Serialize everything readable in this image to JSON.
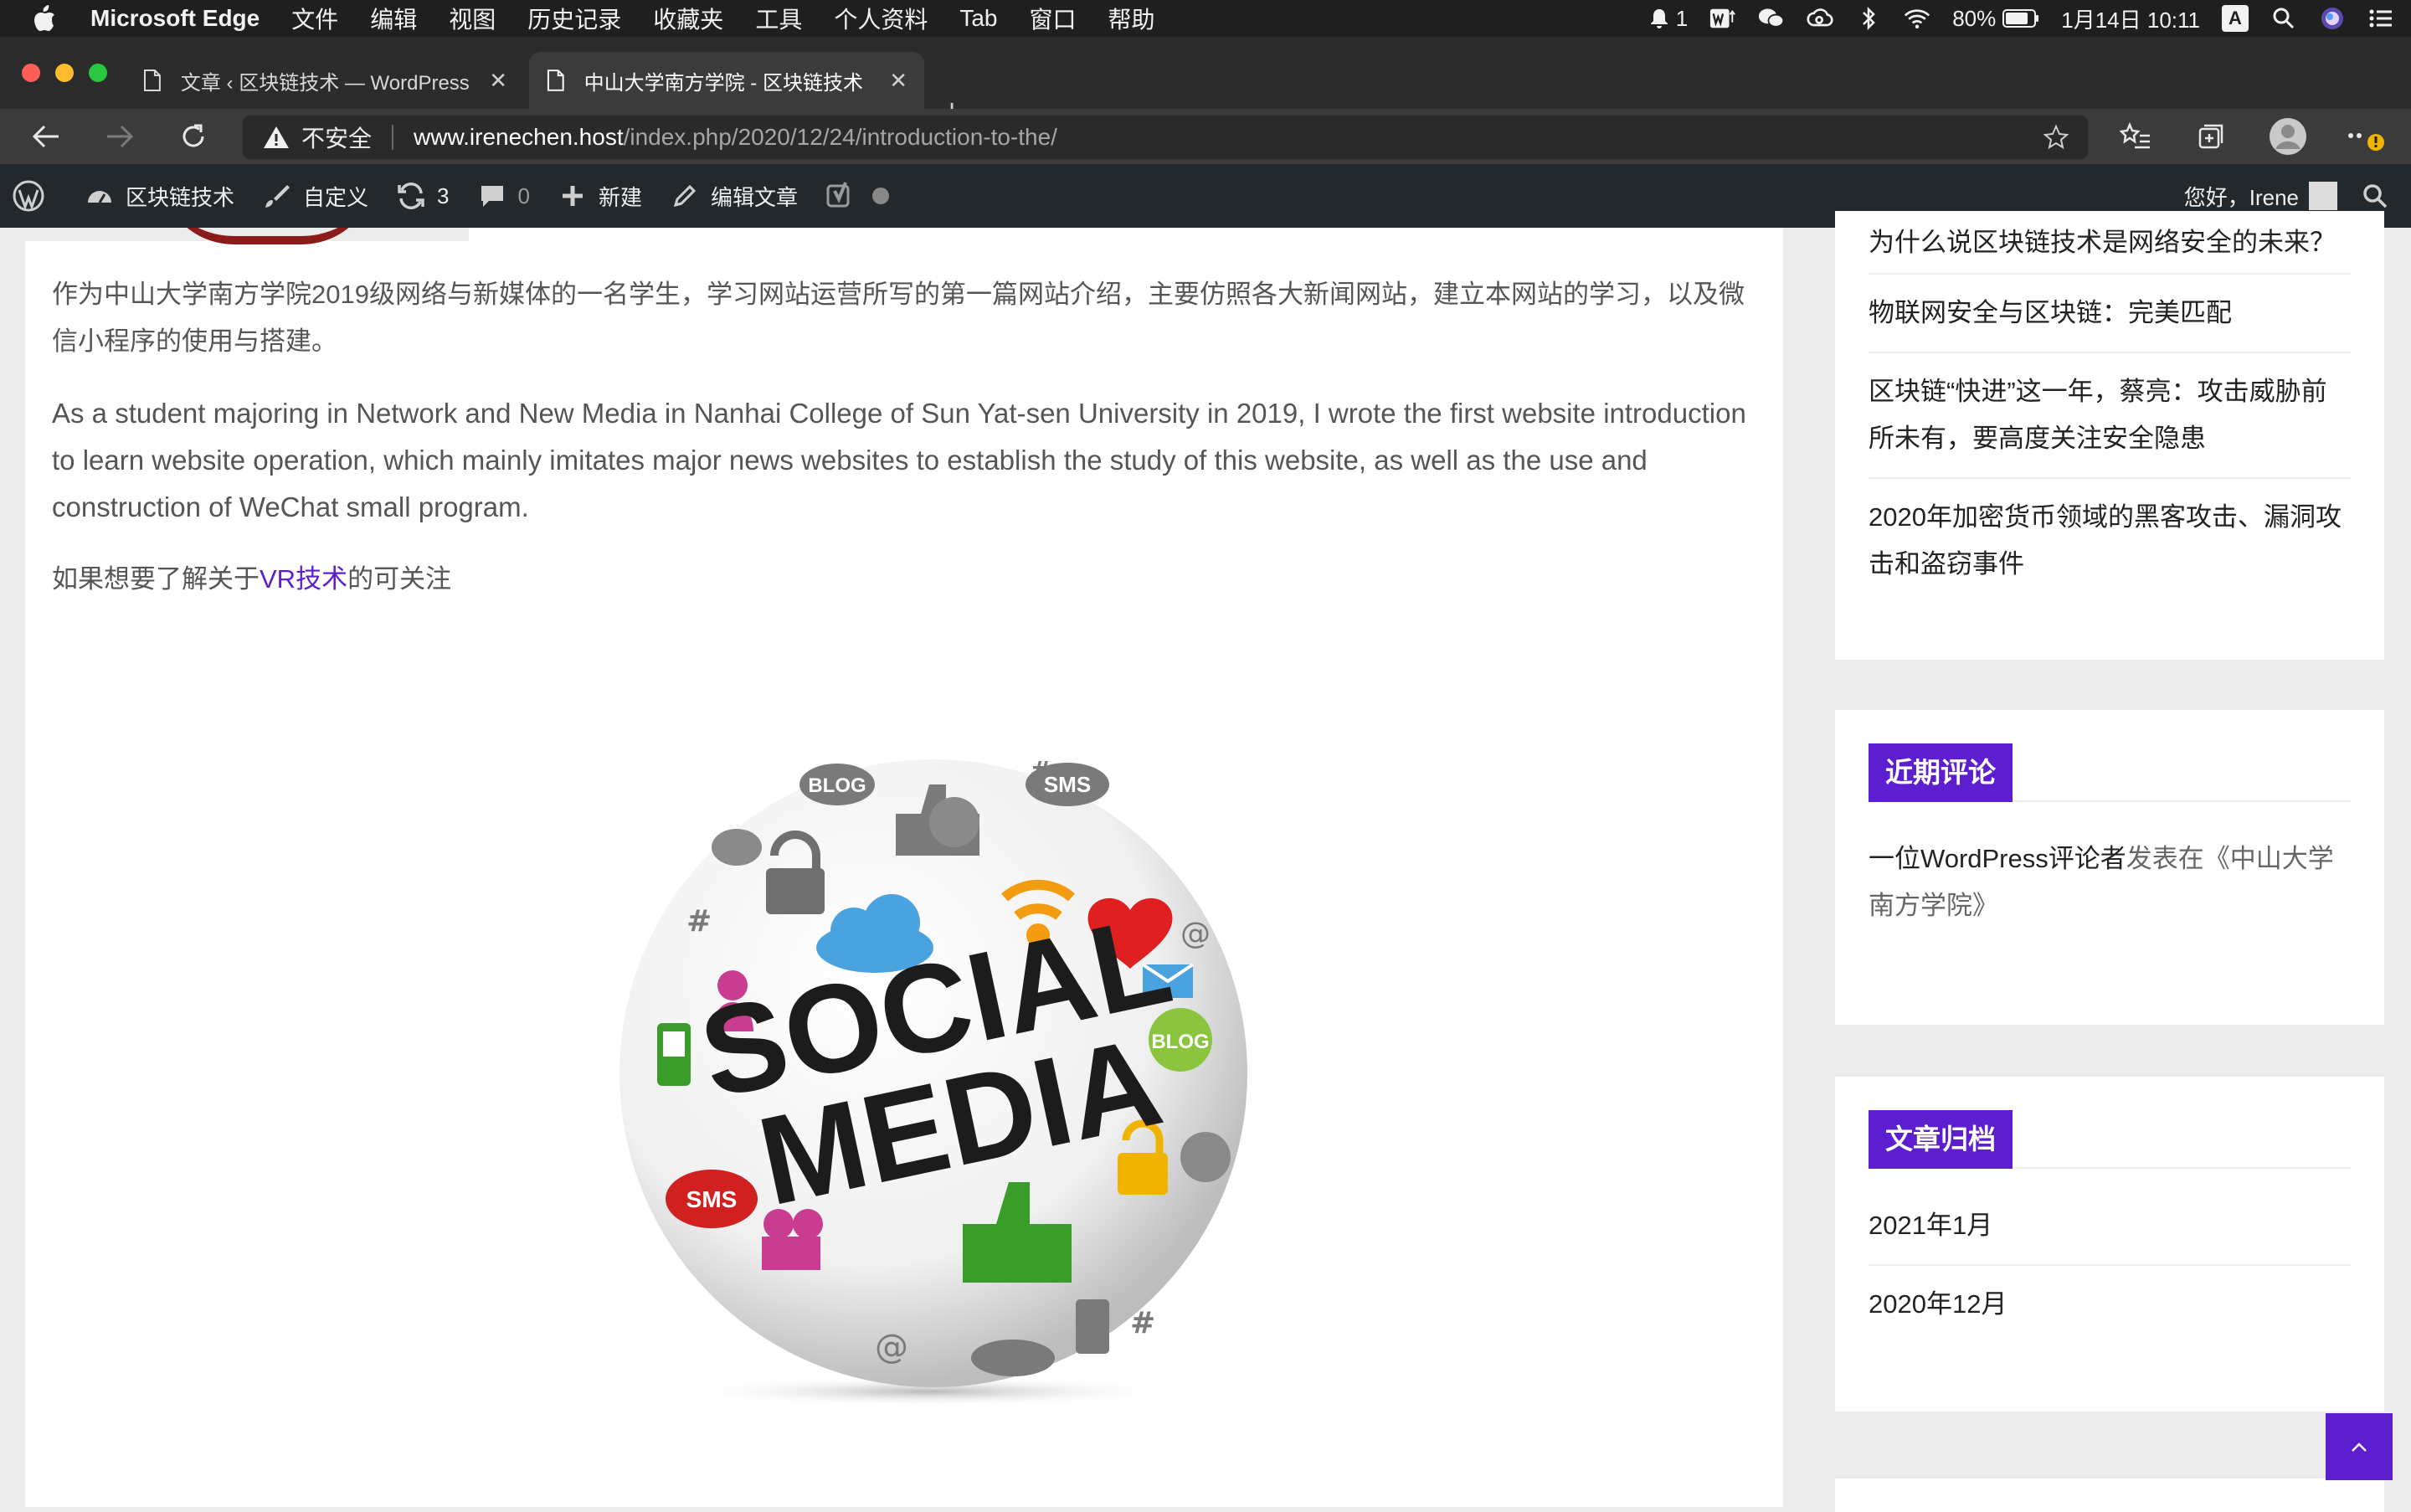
{
  "menubar": {
    "app_name": "Microsoft Edge",
    "items": [
      "文件",
      "编辑",
      "视图",
      "历史记录",
      "收藏夹",
      "工具",
      "个人资料",
      "Tab",
      "窗口",
      "帮助"
    ],
    "notification_count": "1",
    "battery": "80%",
    "datetime": "1月14日  10:11",
    "input_method": "A"
  },
  "tabs": [
    {
      "title": "文章 ‹ 区块链技术 — WordPress",
      "active": false
    },
    {
      "title": "中山大学南方学院 - 区块链技术",
      "active": true
    }
  ],
  "address": {
    "security_label": "不安全",
    "host": "www.irenechen.host",
    "path": "/index.php/2020/12/24/introduction-to-the/"
  },
  "wpbar": {
    "site_name": "区块链技术",
    "customize": "自定义",
    "updates": "3",
    "comments": "0",
    "new_label": "新建",
    "edit_label": "编辑文章",
    "greeting": "您好，Irene"
  },
  "article": {
    "para_cn": "作为中山大学南方学院2019级网络与新媒体的一名学生，学习网站运营所写的第一篇网站介绍，主要仿照各大新闻网站，建立本网站的学习，以及微信小程序的使用与搭建。",
    "para_en": "As a student majoring in Network and New Media in Nanhai College of Sun Yat-sen University in 2019, I wrote the first website introduction to learn website operation, which mainly imitates major news websites to establish the study of this website, as well as the use and construction of WeChat small program.",
    "vr_prefix": "如果想要了解关于",
    "vr_link": "VR技术",
    "vr_suffix": "的可关注",
    "image_text_1": "SOCIAL",
    "image_text_2": "MEDIA",
    "image_badges": {
      "blog": "BLOG",
      "sms": "SMS"
    }
  },
  "sidebar": {
    "recent_posts": [
      "为什么说区块链技术是网络安全的未来？",
      "物联网安全与区块链：完美匹配",
      "区块链“快进”这一年，蔡亮：攻击威胁前所未有，要高度关注安全隐患",
      "2020年加密货币领域的黑客攻击、漏洞攻击和盗窃事件"
    ],
    "comments_title": "近期评论",
    "comment": {
      "author": "一位WordPress评论者",
      "on": "发表在",
      "post": "《中山大学南方学院》"
    },
    "archives_title": "文章归档",
    "archives": [
      "2021年1月",
      "2020年12月"
    ]
  },
  "colors": {
    "accent": "#5d1ed0",
    "wpbar": "#23282d"
  }
}
